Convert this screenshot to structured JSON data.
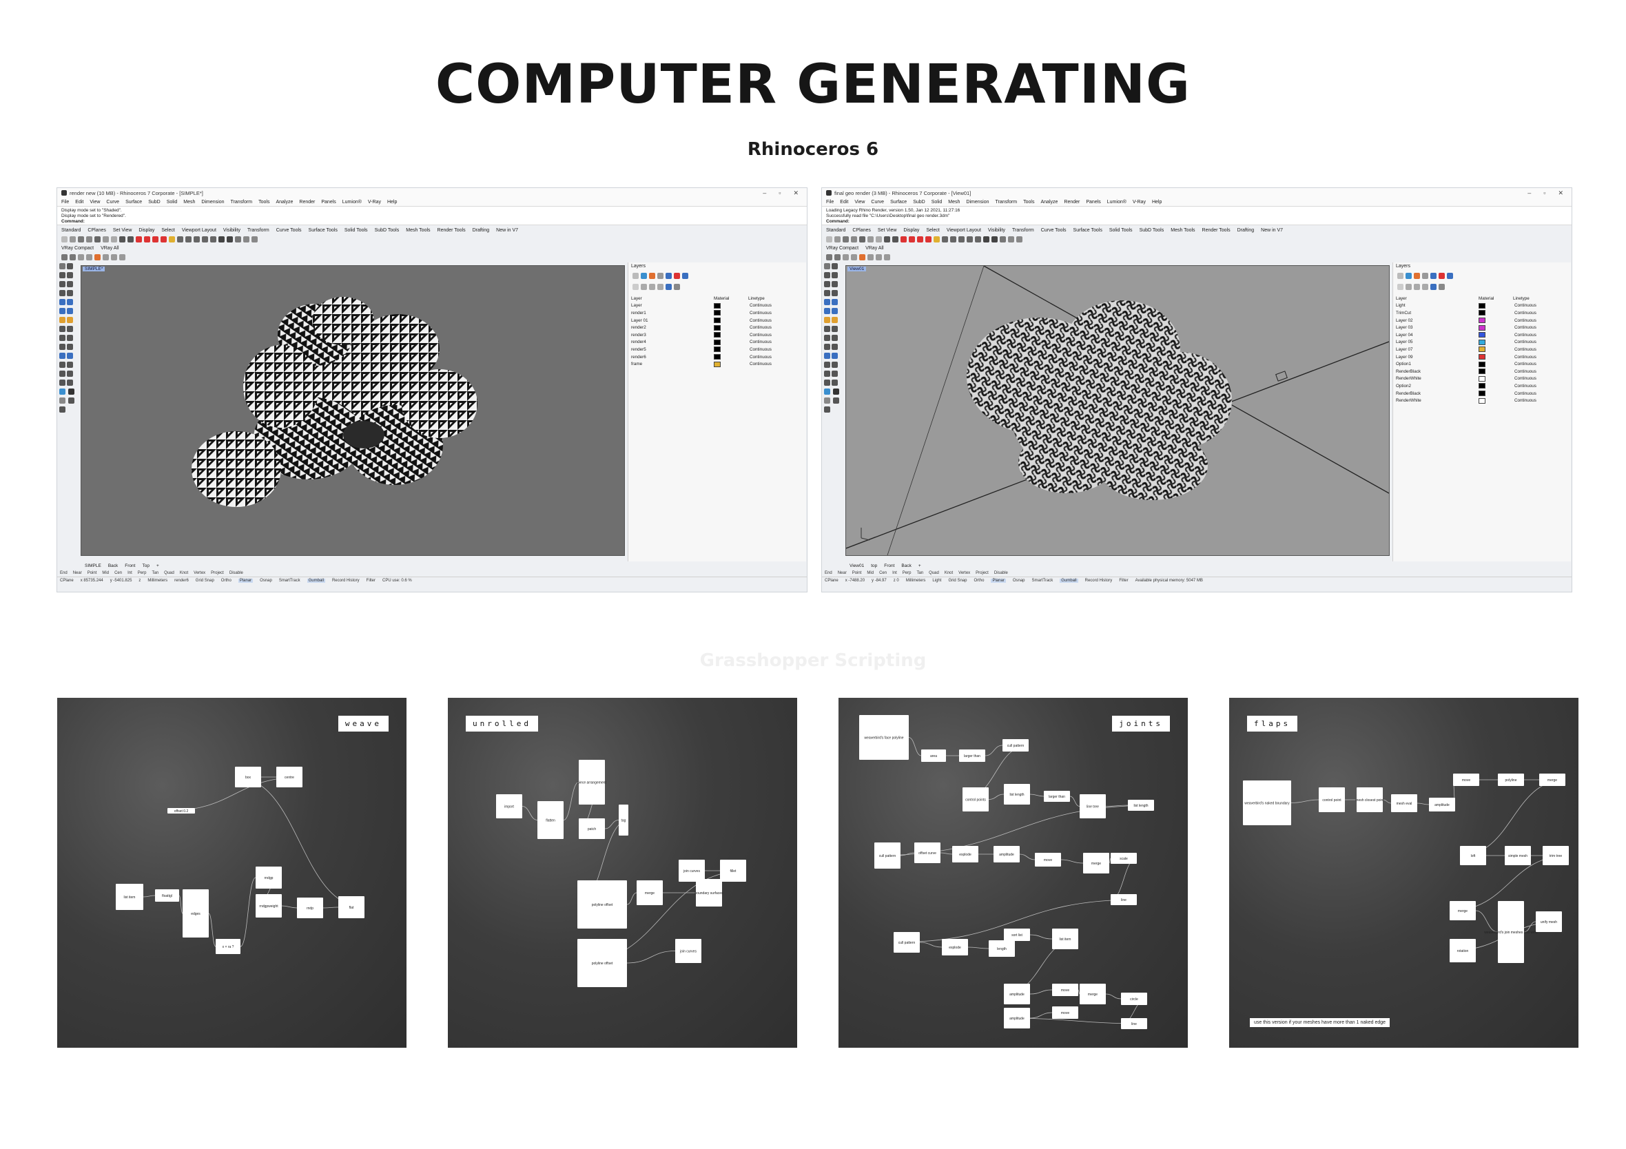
{
  "page": {
    "title": "COMPUTER GENERATING",
    "subtitle": "Rhinoceros 6",
    "section_title": "Grasshopper Scripting"
  },
  "rhino_left": {
    "window_title": "render new (10 MB) - Rhinoceros 7 Corporate - [SIMPLE*]",
    "menu": [
      "File",
      "Edit",
      "View",
      "Curve",
      "Surface",
      "SubD",
      "Solid",
      "Mesh",
      "Dimension",
      "Transform",
      "Tools",
      "Analyze",
      "Render",
      "Panels",
      "Lumion®",
      "V-Ray",
      "Help"
    ],
    "command_lines": [
      "Display mode set to \"Shaded\".",
      "Display mode set to \"Rendered\".",
      "Command:"
    ],
    "tabs": [
      "Standard",
      "CPlanes",
      "Set View",
      "Display",
      "Select",
      "Viewport Layout",
      "Visibility",
      "Transform",
      "Curve Tools",
      "Surface Tools",
      "Solid Tools",
      "SubD Tools",
      "Mesh Tools",
      "Render Tools",
      "Drafting",
      "New in V7"
    ],
    "toolbar2": [
      "VRay Compact",
      "VRay All"
    ],
    "viewport_label": "SIMPLE*",
    "layers_title": "Layers",
    "layer_header": {
      "name": "Layer",
      "material": "Material",
      "linetype": "Linetype"
    },
    "layers": [
      {
        "name": "Layer",
        "color": "#000000"
      },
      {
        "name": "render1",
        "color": "#000000"
      },
      {
        "name": "Layer 01",
        "color": "#000000"
      },
      {
        "name": "render2",
        "color": "#000000"
      },
      {
        "name": "render3",
        "color": "#000000"
      },
      {
        "name": "render4",
        "color": "#000000"
      },
      {
        "name": "render5",
        "color": "#000000"
      },
      {
        "name": "render6",
        "color": "#000000"
      },
      {
        "name": "frame",
        "color": "#e0b030"
      }
    ],
    "layer_linetype": "Continuous",
    "view_tabs": [
      "SIMPLE",
      "Back",
      "Front",
      "Top"
    ],
    "osnap": [
      "End",
      "Near",
      "Point",
      "Mid",
      "Cen",
      "Int",
      "Perp",
      "Tan",
      "Quad",
      "Knot",
      "Vertex",
      "Project",
      "Disable"
    ],
    "status": {
      "cplane": "CPlane",
      "x": "x 85735.244",
      "y": "y -5401.825",
      "z": "z",
      "units": "Millimeters",
      "layer": "render6",
      "items": [
        "Grid Snap",
        "Ortho",
        "Planar",
        "Osnap",
        "SmartTrack",
        "Gumball",
        "Record History",
        "Filter"
      ],
      "info": "CPU use: 0.6 %"
    }
  },
  "rhino_right": {
    "window_title": "final geo render (3 MB) - Rhinoceros 7 Corporate - [View01]",
    "menu": [
      "File",
      "Edit",
      "View",
      "Curve",
      "Surface",
      "SubD",
      "Solid",
      "Mesh",
      "Dimension",
      "Transform",
      "Tools",
      "Analyze",
      "Render",
      "Panels",
      "Lumion®",
      "V-Ray",
      "Help"
    ],
    "command_lines": [
      "Loading Legacy Rhino Render, version 1.50, Jan 12 2021, 11:27:16",
      "Successfully read file \"C:\\Users\\Desktop\\final geo render.3dm\"",
      "Command:"
    ],
    "tabs": [
      "Standard",
      "CPlanes",
      "Set View",
      "Display",
      "Select",
      "Viewport Layout",
      "Visibility",
      "Transform",
      "Curve Tools",
      "Surface Tools",
      "Solid Tools",
      "SubD Tools",
      "Mesh Tools",
      "Render Tools",
      "Drafting",
      "New in V7"
    ],
    "toolbar2": [
      "VRay Compact",
      "VRay All"
    ],
    "viewport_label": "View01",
    "layers_title": "Layers",
    "layer_header": {
      "name": "Layer",
      "material": "Material",
      "linetype": "Linetype"
    },
    "layers": [
      {
        "name": "Light",
        "color": "#000000"
      },
      {
        "name": "TrimCut",
        "color": "#000000"
      },
      {
        "name": "Layer 02",
        "color": "#cc33cc"
      },
      {
        "name": "Layer 03",
        "color": "#cc33cc"
      },
      {
        "name": "Layer 04",
        "color": "#3355dd"
      },
      {
        "name": "Layer 05",
        "color": "#33aadd"
      },
      {
        "name": "Layer 07",
        "color": "#e0b030"
      },
      {
        "name": "Layer 09",
        "color": "#dd3333"
      },
      {
        "name": "Option1",
        "color": "#000000"
      },
      {
        "name": "RenderBlack",
        "color": "#000000"
      },
      {
        "name": "RenderWhite",
        "color": "#ffffff"
      },
      {
        "name": "Option2",
        "color": "#000000"
      },
      {
        "name": "RenderBlack",
        "color": "#000000"
      },
      {
        "name": "RenderWhite",
        "color": "#ffffff"
      }
    ],
    "layer_linetype": "Continuous",
    "view_tabs": [
      "View01",
      "top",
      "Front",
      "Back"
    ],
    "osnap": [
      "End",
      "Near",
      "Point",
      "Mid",
      "Cen",
      "Int",
      "Perp",
      "Tan",
      "Quad",
      "Knot",
      "Vertex",
      "Project",
      "Disable"
    ],
    "status": {
      "cplane": "CPlane",
      "x": "x -7488.20",
      "y": "y -84.97",
      "z": "z 0",
      "units": "Millimeters",
      "layer": "Light",
      "items": [
        "Grid Snap",
        "Ortho",
        "Planar",
        "Osnap",
        "SmartTrack",
        "Gumball",
        "Record History",
        "Filter"
      ],
      "info": "Available physical memory: 5047 MB"
    }
  },
  "grasshopper": [
    {
      "label": "weave",
      "nodes": [
        "list item",
        "floattgl",
        "edges",
        "x × ra ?",
        "rndgp",
        "rndgpweight",
        "rndp",
        "flat",
        "box",
        "centre",
        "offset 0.2"
      ]
    },
    {
      "label": "unrolled",
      "nodes": [
        "import",
        "flatten",
        "piece arrangement",
        "patch",
        "tag",
        "polyline offset",
        "merge",
        "boundary surfaces",
        "join curves",
        "fillet",
        "polyline offset",
        "join curves"
      ]
    },
    {
      "label": "joints",
      "nodes": [
        "weaverbird's face polyline",
        "area",
        "larger than",
        "cull pattern",
        "control points",
        "list length",
        "larger than",
        "line tree",
        "list length",
        "cull pattern",
        "offset curve",
        "explode",
        "amplitude",
        "move",
        "merge",
        "scale",
        "line",
        "cull pattern",
        "explode",
        "length",
        "sort list",
        "list item",
        "amplitude",
        "move",
        "merge",
        "circle",
        "line",
        "amplitude",
        "move"
      ]
    },
    {
      "label": "flaps",
      "nodes": [
        "weaverbird's naked boundary",
        "control point",
        "mesh closest point",
        "mesh eval",
        "amplitude",
        "move",
        "polyline",
        "merge",
        "loft",
        "simple mesh",
        "trim tree",
        "merge",
        "weaverbird's join meshes and weld",
        "unify mesh",
        "rotation"
      ],
      "note": "use this version if your meshes have more than 1 naked edge"
    }
  ]
}
